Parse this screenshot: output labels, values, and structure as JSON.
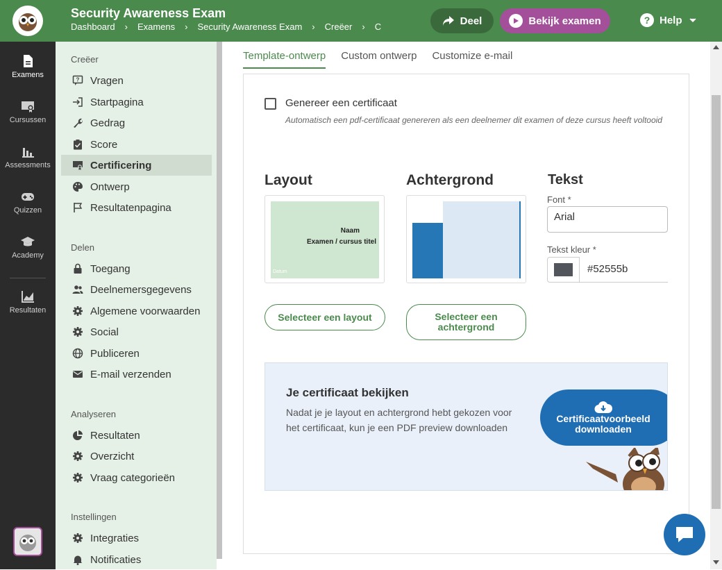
{
  "header": {
    "title": "Security Awareness Exam",
    "breadcrumbs": [
      "Dashboard",
      "Examens",
      "Security Awareness Exam",
      "Creëer",
      "C"
    ],
    "share_label": "Deel",
    "view_label": "Bekijk examen",
    "help_label": "Help"
  },
  "leftnav": {
    "items": [
      {
        "label": "Examens",
        "icon": "document-icon",
        "active": true
      },
      {
        "label": "Cursussen",
        "icon": "certificate-icon"
      },
      {
        "label": "Assessments",
        "icon": "bar-chart-icon"
      },
      {
        "label": "Quizzen",
        "icon": "gamepad-icon"
      },
      {
        "label": "Academy",
        "icon": "graduation-cap-icon"
      },
      {
        "label": "Resultaten",
        "icon": "line-chart-icon"
      }
    ]
  },
  "sidebar": {
    "sections": [
      {
        "title": "Creëer",
        "items": [
          "Vragen",
          "Startpagina",
          "Gedrag",
          "Score",
          "Certificering",
          "Ontwerp",
          "Resultatenpagina"
        ]
      },
      {
        "title": "Delen",
        "items": [
          "Toegang",
          "Deelnemersgegevens",
          "Algemene voorwaarden",
          "Social",
          "Publiceren",
          "E-mail verzenden"
        ]
      },
      {
        "title": "Analyseren",
        "items": [
          "Resultaten",
          "Overzicht",
          "Vraag categorieën"
        ]
      },
      {
        "title": "Instellingen",
        "items": [
          "Integraties",
          "Notificaties"
        ]
      }
    ],
    "active_item": "Certificering"
  },
  "tabs": [
    "Template-ontwerp",
    "Custom ontwerp",
    "Customize e-mail"
  ],
  "certificate": {
    "checkbox_label": "Genereer een certificaat",
    "checkbox_hint": "Automatisch een pdf-certificaat genereren als een deelnemer dit examen of deze cursus heeft voltooid",
    "checked": false
  },
  "layout": {
    "title": "Layout",
    "preview_name": "Naam",
    "preview_subtitle": "Examen / cursus titel",
    "preview_date": "Datum",
    "button": "Selecteer een layout"
  },
  "background": {
    "title": "Achtergrond",
    "button": "Selecteer een achtergrond"
  },
  "text": {
    "title": "Tekst",
    "font_label": "Font *",
    "font_value": "Arial",
    "color_label": "Tekst kleur *",
    "color_value": "#52555b"
  },
  "preview": {
    "title": "Je certificaat bekijken",
    "description": "Nadat je je layout en achtergrond hebt gekozen voor het certificaat, kun je een PDF preview downloaden",
    "button": "Certificaatvoorbeeld downloaden"
  },
  "colors": {
    "brand_green": "#4a8a4c",
    "purple": "#a34f9a",
    "blue": "#1f6db3",
    "text_color": "#52555b"
  }
}
